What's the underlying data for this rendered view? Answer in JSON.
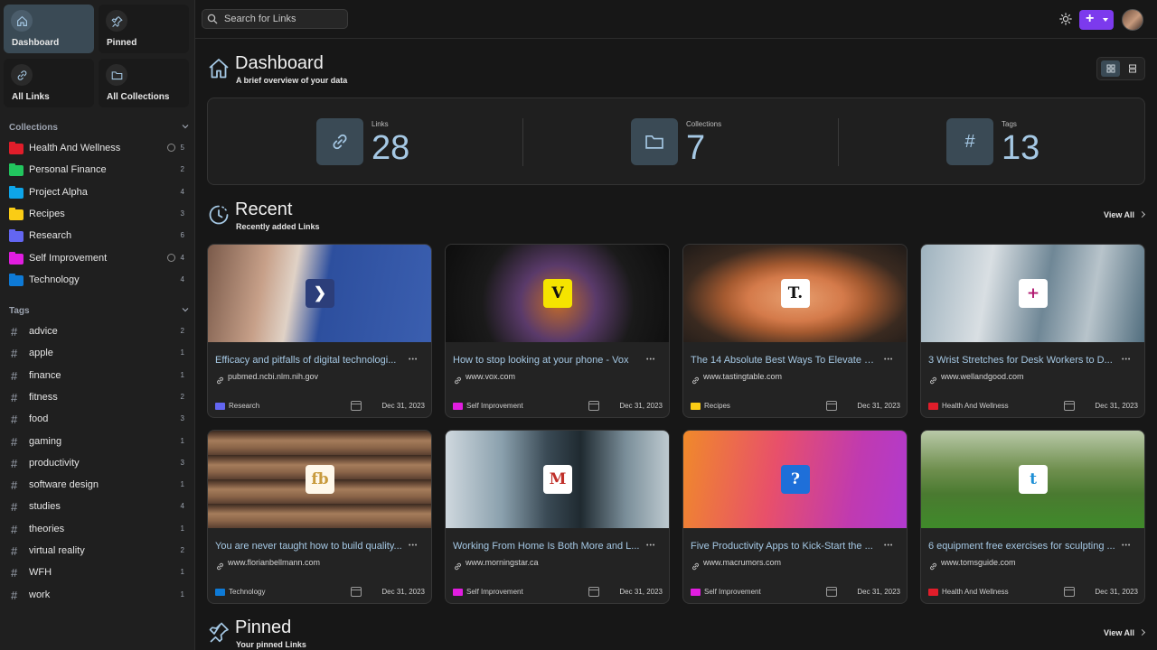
{
  "sidebar": {
    "nav": [
      {
        "label": "Dashboard",
        "icon": "house-icon",
        "active": true
      },
      {
        "label": "Pinned",
        "icon": "pin-icon",
        "active": false
      },
      {
        "label": "All Links",
        "icon": "link-icon",
        "active": false
      },
      {
        "label": "All Collections",
        "icon": "folder-icon",
        "active": false
      }
    ],
    "collections_title": "Collections",
    "collections": [
      {
        "name": "Health And Wellness",
        "count": "5",
        "color": "#e11d2a",
        "public": true
      },
      {
        "name": "Personal Finance",
        "count": "2",
        "color": "#22c55e",
        "public": false
      },
      {
        "name": "Project Alpha",
        "count": "4",
        "color": "#0ea5e9",
        "public": false
      },
      {
        "name": "Recipes",
        "count": "3",
        "color": "#facc15",
        "public": false
      },
      {
        "name": "Research",
        "count": "6",
        "color": "#6366f1",
        "public": false
      },
      {
        "name": "Self Improvement",
        "count": "4",
        "color": "#e11de0",
        "public": true
      },
      {
        "name": "Technology",
        "count": "4",
        "color": "#0e7ad6",
        "public": false
      }
    ],
    "tags_title": "Tags",
    "tags": [
      {
        "name": "advice",
        "count": "2"
      },
      {
        "name": "apple",
        "count": "1"
      },
      {
        "name": "finance",
        "count": "1"
      },
      {
        "name": "fitness",
        "count": "2"
      },
      {
        "name": "food",
        "count": "3"
      },
      {
        "name": "gaming",
        "count": "1"
      },
      {
        "name": "productivity",
        "count": "3"
      },
      {
        "name": "software design",
        "count": "1"
      },
      {
        "name": "studies",
        "count": "4"
      },
      {
        "name": "theories",
        "count": "1"
      },
      {
        "name": "virtual reality",
        "count": "2"
      },
      {
        "name": "WFH",
        "count": "1"
      },
      {
        "name": "work",
        "count": "1"
      }
    ]
  },
  "topbar": {
    "search_placeholder": "Search for Links",
    "add_label": "+"
  },
  "dashboard": {
    "title": "Dashboard",
    "subtitle": "A brief overview of your data",
    "stats": [
      {
        "label": "Links",
        "value": "28",
        "icon": "link-icon"
      },
      {
        "label": "Collections",
        "value": "7",
        "icon": "folder-icon"
      },
      {
        "label": "Tags",
        "value": "13",
        "icon": "hash-icon"
      }
    ]
  },
  "recent": {
    "title": "Recent",
    "subtitle": "Recently added Links",
    "view_all": "View All",
    "cards": [
      {
        "title": "Efficacy and pitfalls of digital technologi...",
        "url": "pubmed.ncbi.nlm.nih.gov",
        "collection": "Research",
        "color": "#6366f1",
        "date": "Dec 31, 2023",
        "logo": "❯",
        "logo_bg": "#2c3e7a",
        "logo_fg": "#ffffff",
        "thumb": "linear-gradient(100deg,#7a5a4a 0%,#c7a089 25%,#e0d2c6 38%,#2d4f9e 52%,#3b5fb0 100%)"
      },
      {
        "title": "How to stop looking at your phone - Vox",
        "url": "www.vox.com",
        "collection": "Self Improvement",
        "color": "#e11de0",
        "date": "Dec 31, 2023",
        "logo": "V",
        "logo_bg": "#f5e400",
        "logo_fg": "#111111",
        "thumb": "radial-gradient(circle at 50% 60%,#c06a2a 0%,#5a3a6a 30%,#1a1a1a 60%,#0d0d0d 100%)"
      },
      {
        "title": "The 14 Absolute Best Ways To Elevate Fr...",
        "url": "www.tastingtable.com",
        "collection": "Recipes",
        "color": "#facc15",
        "date": "Dec 31, 2023",
        "logo": "T.",
        "logo_bg": "#ffffff",
        "logo_fg": "#111111",
        "thumb": "radial-gradient(ellipse at 50% 55%,#e8a070 0%,#d47a4a 30%,#a55a30 45%,#3a2a20 70%,#1e1a18 100%)"
      },
      {
        "title": "3 Wrist Stretches for Desk Workers to D...",
        "url": "www.wellandgood.com",
        "collection": "Health And Wellness",
        "color": "#e11d2a",
        "date": "Dec 31, 2023",
        "logo": "+",
        "logo_bg": "#ffffff",
        "logo_fg": "#b0186f",
        "thumb": "linear-gradient(100deg,#9eb2be 0%,#d9dfe3 30%,#6f8796 55%,#b8c4cb 75%,#4e6b7c 100%)"
      },
      {
        "title": "You are never taught how to build quality...",
        "url": "www.florianbellmann.com",
        "collection": "Technology",
        "color": "#0e7ad6",
        "date": "Dec 31, 2023",
        "logo": "fb",
        "logo_bg": "#fff8ea",
        "logo_fg": "#c89a3c",
        "thumb": "repeating-linear-gradient(0deg,#5a4030 0px,#8a6448 8px,#a57c5b 16px,#6a4c38 22px,#3a2a20 27px)"
      },
      {
        "title": "Working From Home Is Both More and L...",
        "url": "www.morningstar.ca",
        "collection": "Self Improvement",
        "color": "#e11de0",
        "date": "Dec 31, 2023",
        "logo": "M",
        "logo_bg": "#ffffff",
        "logo_fg": "#c0302a",
        "thumb": "linear-gradient(90deg,#cfd8de 0%,#8aa0ad 25%,#3a4a55 45%,#1f2a30 60%,#7a8e99 80%,#c0ccd2 100%)"
      },
      {
        "title": "Five Productivity Apps to Kick-Start the ...",
        "url": "www.macrumors.com",
        "collection": "Self Improvement",
        "color": "#e11de0",
        "date": "Dec 31, 2023",
        "logo": "?",
        "logo_bg": "#1e6fd9",
        "logo_fg": "#ffffff",
        "thumb": "linear-gradient(100deg,#f08a2a 0%,#e8506a 40%,#c03ab0 75%,#b03ad0 100%)"
      },
      {
        "title": "6 equipment free exercises for sculpting ...",
        "url": "www.tomsguide.com",
        "collection": "Health And Wellness",
        "color": "#e11d2a",
        "date": "Dec 31, 2023",
        "logo": "t",
        "logo_bg": "#ffffff",
        "logo_fg": "#1e90d6",
        "thumb": "linear-gradient(180deg,#b9c9a8 0%,#6f8f4e 40%,#4a7a30 65%,#3f8a2a 100%)"
      }
    ]
  },
  "pinned": {
    "title": "Pinned",
    "subtitle": "Your pinned Links",
    "view_all": "View All"
  }
}
